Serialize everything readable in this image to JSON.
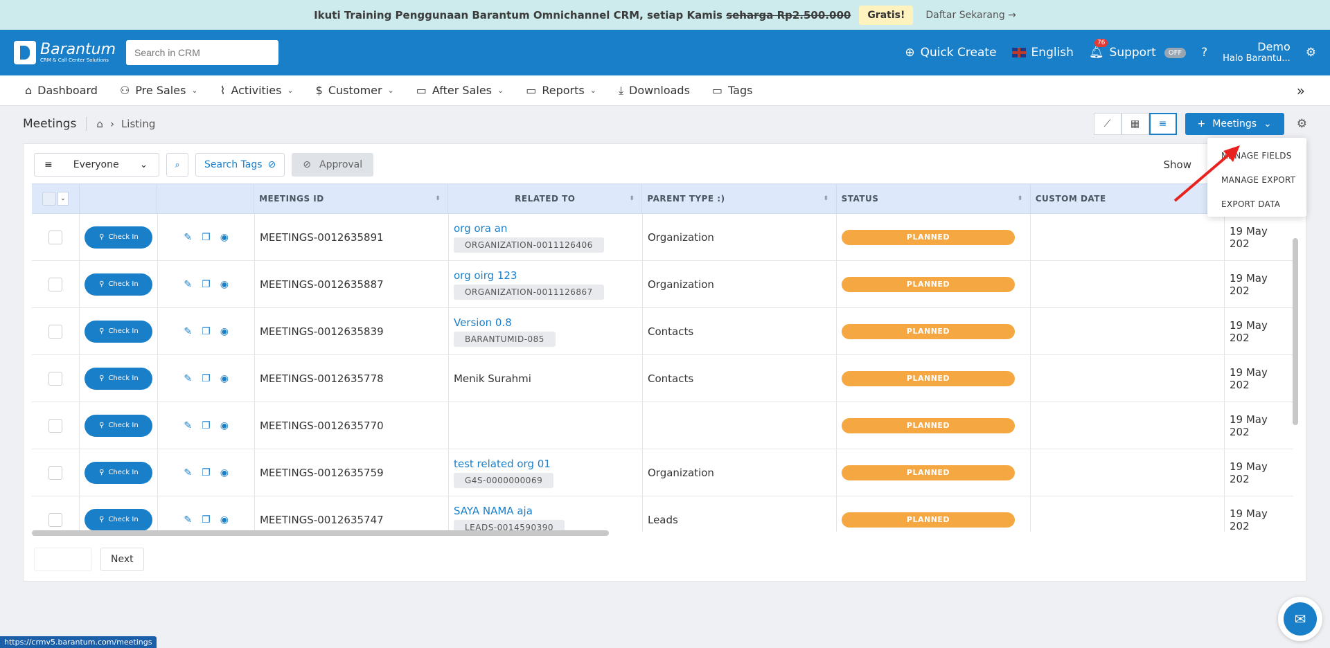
{
  "promo": {
    "text": "Ikuti Training Penggunaan Barantum Omnichannel CRM, setiap Kamis",
    "strike": "seharga Rp2.500.000",
    "badge": "Gratis!",
    "link": "Daftar Sekarang →"
  },
  "header": {
    "logo_name": "Barantum",
    "logo_tag": "CRM & Call Center Solutions",
    "search_placeholder": "Search in CRM",
    "quick_create": "Quick Create",
    "language": "English",
    "notif_count": "76",
    "support": "Support",
    "support_toggle": "OFF",
    "user_name": "Demo",
    "user_sub": "Halo Barantu..."
  },
  "nav": {
    "items": [
      {
        "label": "Dashboard",
        "icon": "home-icon",
        "caret": false
      },
      {
        "label": "Pre Sales",
        "icon": "users-icon",
        "caret": true
      },
      {
        "label": "Activities",
        "icon": "activity-icon",
        "caret": true
      },
      {
        "label": "Customer",
        "icon": "dollar-icon",
        "caret": true
      },
      {
        "label": "After Sales",
        "icon": "folder-icon",
        "caret": true
      },
      {
        "label": "Reports",
        "icon": "folder-icon",
        "caret": true
      },
      {
        "label": "Downloads",
        "icon": "download-icon",
        "caret": false
      },
      {
        "label": "Tags",
        "icon": "folder-icon",
        "caret": false
      }
    ]
  },
  "page": {
    "title": "Meetings",
    "breadcrumb": "Listing",
    "add_button": "Meetings"
  },
  "filters": {
    "assignee": "Everyone",
    "search_tags": "Search Tags",
    "approval": "Approval",
    "show_label": "Show"
  },
  "table": {
    "headers": [
      "MEETINGS ID",
      "RELATED TO",
      "PARENT TYPE :)",
      "STATUS",
      "CUSTOM DATE"
    ],
    "checkin_label": "Check In",
    "rows": [
      {
        "id": "MEETINGS-0012635891",
        "related": "org ora an",
        "related_tag": "ORGANIZATION-0011126406",
        "related_plain": "",
        "parent": "Organization",
        "status": "PLANNED",
        "custom_date": "",
        "date": "19 May 202"
      },
      {
        "id": "MEETINGS-0012635887",
        "related": "org oirg 123",
        "related_tag": "ORGANIZATION-0011126867",
        "related_plain": "",
        "parent": "Organization",
        "status": "PLANNED",
        "custom_date": "",
        "date": "19 May 202"
      },
      {
        "id": "MEETINGS-0012635839",
        "related": "Version 0.8",
        "related_tag": "BARANTUMID-085",
        "related_plain": "",
        "parent": "Contacts",
        "status": "PLANNED",
        "custom_date": "",
        "date": "19 May 202"
      },
      {
        "id": "MEETINGS-0012635778",
        "related": "",
        "related_tag": "",
        "related_plain": "Menik Surahmi",
        "parent": "Contacts",
        "status": "PLANNED",
        "custom_date": "",
        "date": "19 May 202"
      },
      {
        "id": "MEETINGS-0012635770",
        "related": "",
        "related_tag": "",
        "related_plain": "",
        "parent": "",
        "status": "PLANNED",
        "custom_date": "",
        "date": "19 May 202"
      },
      {
        "id": "MEETINGS-0012635759",
        "related": "test related org 01",
        "related_tag": "G4S-0000000069",
        "related_plain": "",
        "parent": "Organization",
        "status": "PLANNED",
        "custom_date": "",
        "date": "19 May 202"
      },
      {
        "id": "MEETINGS-0012635747",
        "related": "SAYA NAMA aja",
        "related_tag": "LEADS-0014590390",
        "related_plain": "",
        "parent": "Leads",
        "status": "PLANNED",
        "custom_date": "",
        "date": "19 May 202"
      }
    ]
  },
  "pager": {
    "next": "Next"
  },
  "dropdown": {
    "items": [
      "MANAGE FIELDS",
      "MANAGE EXPORT",
      "EXPORT DATA"
    ]
  },
  "statusbar": {
    "url": "https://crmv5.barantum.com/meetings"
  },
  "colors": {
    "primary": "#1a7fc9",
    "status_planned": "#f5a742",
    "promo_bg": "#cdebec",
    "annotation_arrow": "#e8231f"
  }
}
